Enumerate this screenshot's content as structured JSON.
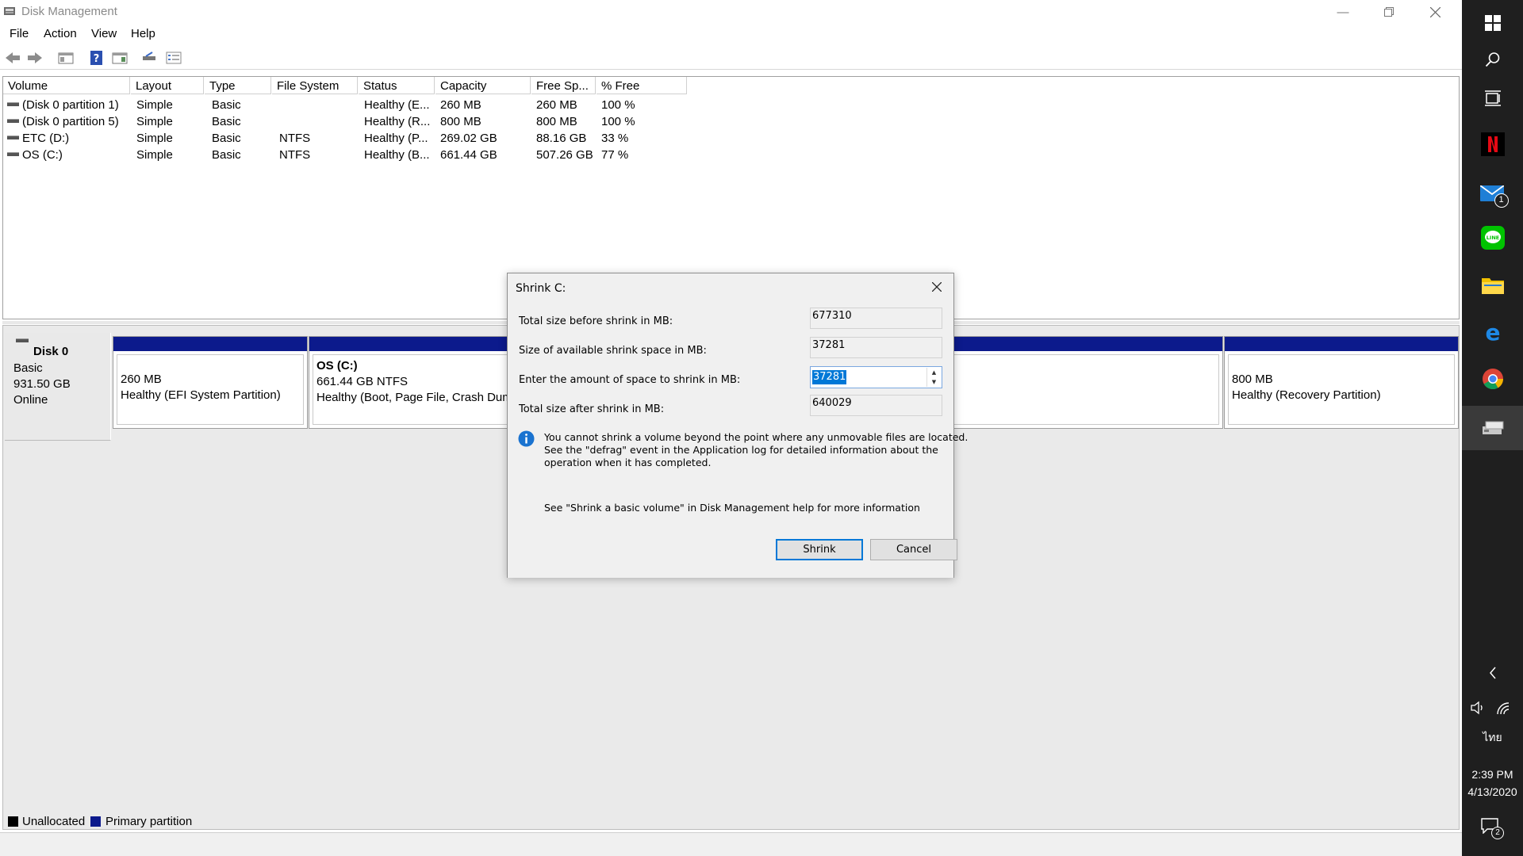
{
  "window": {
    "title": "Disk Management",
    "menus": [
      "File",
      "Action",
      "View",
      "Help"
    ]
  },
  "volume_list": {
    "columns": [
      "Volume",
      "Layout",
      "Type",
      "File System",
      "Status",
      "Capacity",
      "Free Sp...",
      "% Free"
    ],
    "rows": [
      [
        "(Disk 0 partition 1)",
        "Simple",
        "Basic",
        "",
        "Healthy (E...",
        "260 MB",
        "260 MB",
        "100 %"
      ],
      [
        "(Disk 0 partition 5)",
        "Simple",
        "Basic",
        "",
        "Healthy (R...",
        "800 MB",
        "800 MB",
        "100 %"
      ],
      [
        "ETC (D:)",
        "Simple",
        "Basic",
        "NTFS",
        "Healthy (P...",
        "269.02 GB",
        "88.16 GB",
        "33 %"
      ],
      [
        "OS (C:)",
        "Simple",
        "Basic",
        "NTFS",
        "Healthy (B...",
        "661.44 GB",
        "507.26 GB",
        "77 %"
      ]
    ]
  },
  "disk": {
    "name": "Disk 0",
    "type": "Basic",
    "size": "931.50 GB",
    "state": "Online",
    "partitions": [
      {
        "title": "",
        "size": "260 MB",
        "status": "Healthy (EFI System Partition)"
      },
      {
        "title": "OS  (C:)",
        "size": "661.44 GB NTFS",
        "status": "Healthy (Boot, Page File, Crash Dump"
      },
      {
        "title": "",
        "size": "",
        "status": ""
      },
      {
        "title": "",
        "size": "800 MB",
        "status": "Healthy (Recovery Partition)"
      }
    ]
  },
  "legend": {
    "unallocated": "Unallocated",
    "primary": "Primary partition",
    "unallocated_color": "#000000",
    "primary_color": "#0c1a8c"
  },
  "dialog": {
    "title": "Shrink C:",
    "total_before_label": "Total size before shrink in MB:",
    "total_before_value": "677310",
    "available_label": "Size of available shrink space in MB:",
    "available_value": "37281",
    "amount_label": "Enter the amount of space to shrink in MB:",
    "amount_value": "37281",
    "total_after_label": "Total size after shrink in MB:",
    "total_after_value": "640029",
    "info_line1": "You cannot shrink a volume beyond the point where any unmovable files are located.",
    "info_line2": "See the \"defrag\" event in the Application log for detailed information about the",
    "info_line3": "operation when it has completed.",
    "help_text": "See \"Shrink a basic volume\" in Disk Management help for more information",
    "shrink_button": "Shrink",
    "cancel_button": "Cancel"
  },
  "taskbar": {
    "mail_badge": "1",
    "language": "ไทย",
    "time": "2:39 PM",
    "date": "4/13/2020",
    "notification_badge": "2",
    "icons": [
      "windows-icon",
      "search-icon",
      "task-view-icon",
      "netflix-icon",
      "mail-icon",
      "line-icon",
      "file-explorer-icon",
      "edge-icon",
      "chrome-icon",
      "disk-management-icon"
    ]
  }
}
